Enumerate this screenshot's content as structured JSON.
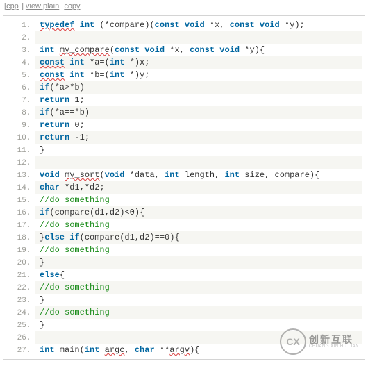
{
  "toolbar": {
    "lang": "cpp",
    "viewplain": "view plain",
    "copy": "copy"
  },
  "code": {
    "lines": [
      [
        [
          "kw squiggle",
          "typedef"
        ],
        [
          "plain",
          " "
        ],
        [
          "type",
          "int"
        ],
        [
          "plain",
          " (*compare)("
        ],
        [
          "kw",
          "const"
        ],
        [
          "plain",
          " "
        ],
        [
          "type",
          "void"
        ],
        [
          "plain",
          " *x, "
        ],
        [
          "kw",
          "const"
        ],
        [
          "plain",
          " "
        ],
        [
          "type",
          "void"
        ],
        [
          "plain",
          " *y);"
        ]
      ],
      [
        [
          "plain",
          ""
        ]
      ],
      [
        [
          "type",
          "int"
        ],
        [
          "plain",
          " "
        ],
        [
          "plain squiggle",
          "my_compare"
        ],
        [
          "plain",
          "("
        ],
        [
          "kw",
          "const"
        ],
        [
          "plain",
          " "
        ],
        [
          "type",
          "void"
        ],
        [
          "plain",
          " *x, "
        ],
        [
          "kw",
          "const"
        ],
        [
          "plain",
          " "
        ],
        [
          "type",
          "void"
        ],
        [
          "plain",
          " *y){"
        ]
      ],
      [
        [
          "plain",
          "    "
        ],
        [
          "kw squiggle",
          "const"
        ],
        [
          "plain",
          " "
        ],
        [
          "type",
          "int"
        ],
        [
          "plain",
          " *a=("
        ],
        [
          "type",
          "int"
        ],
        [
          "plain",
          " *)x;"
        ]
      ],
      [
        [
          "plain",
          "    "
        ],
        [
          "kw squiggle",
          "const"
        ],
        [
          "plain",
          " "
        ],
        [
          "type",
          "int"
        ],
        [
          "plain",
          " *b=("
        ],
        [
          "type",
          "int"
        ],
        [
          "plain",
          " *)y;"
        ]
      ],
      [
        [
          "plain",
          "    "
        ],
        [
          "kw",
          "if"
        ],
        [
          "plain",
          "(*a>*b)"
        ]
      ],
      [
        [
          "plain",
          "        "
        ],
        [
          "kw",
          "return"
        ],
        [
          "plain",
          " 1;"
        ]
      ],
      [
        [
          "plain",
          "    "
        ],
        [
          "kw",
          "if"
        ],
        [
          "plain",
          "(*a==*b)"
        ]
      ],
      [
        [
          "plain",
          "        "
        ],
        [
          "kw",
          "return"
        ],
        [
          "plain",
          " 0;"
        ]
      ],
      [
        [
          "plain",
          "    "
        ],
        [
          "kw",
          "return"
        ],
        [
          "plain",
          " -1;"
        ]
      ],
      [
        [
          "plain",
          "}"
        ]
      ],
      [
        [
          "plain",
          ""
        ]
      ],
      [
        [
          "type",
          "void"
        ],
        [
          "plain",
          " "
        ],
        [
          "plain squiggle",
          "my_sort"
        ],
        [
          "plain",
          "("
        ],
        [
          "type",
          "void"
        ],
        [
          "plain",
          " *data, "
        ],
        [
          "type",
          "int"
        ],
        [
          "plain",
          " length, "
        ],
        [
          "type",
          "int"
        ],
        [
          "plain",
          " size, compare){"
        ]
      ],
      [
        [
          "plain",
          "    "
        ],
        [
          "type",
          "char"
        ],
        [
          "plain",
          " *d1,*d2;"
        ]
      ],
      [
        [
          "plain",
          "    "
        ],
        [
          "cmnt",
          "//do something"
        ]
      ],
      [
        [
          "plain",
          "    "
        ],
        [
          "kw",
          "if"
        ],
        [
          "plain",
          "(compare(d1,d2)<0){"
        ]
      ],
      [
        [
          "plain",
          "        "
        ],
        [
          "cmnt",
          "//do something"
        ]
      ],
      [
        [
          "plain",
          "    }"
        ],
        [
          "kw",
          "else"
        ],
        [
          "plain",
          " "
        ],
        [
          "kw",
          "if"
        ],
        [
          "plain",
          "(compare(d1,d2)==0){"
        ]
      ],
      [
        [
          "plain",
          "        "
        ],
        [
          "cmnt",
          "//do something"
        ]
      ],
      [
        [
          "plain",
          "    }"
        ]
      ],
      [
        [
          "plain",
          "    "
        ],
        [
          "kw",
          "else"
        ],
        [
          "plain",
          "{"
        ]
      ],
      [
        [
          "plain",
          "        "
        ],
        [
          "cmnt",
          "//do something"
        ]
      ],
      [
        [
          "plain",
          "    }"
        ]
      ],
      [
        [
          "plain",
          "    "
        ],
        [
          "cmnt",
          "//do something"
        ]
      ],
      [
        [
          "plain",
          "}"
        ]
      ],
      [
        [
          "plain",
          ""
        ]
      ],
      [
        [
          "type",
          "int"
        ],
        [
          "plain",
          " main("
        ],
        [
          "type",
          "int"
        ],
        [
          "plain",
          " "
        ],
        [
          "plain squiggle",
          "argc"
        ],
        [
          "plain",
          ", "
        ],
        [
          "type",
          "char"
        ],
        [
          "plain",
          " **"
        ],
        [
          "plain squiggle",
          "argv"
        ],
        [
          "plain",
          "){"
        ]
      ]
    ]
  },
  "watermark": {
    "logo": "CX",
    "cn": "创新互联",
    "en": "CHUANG XIN HU LIAN"
  }
}
